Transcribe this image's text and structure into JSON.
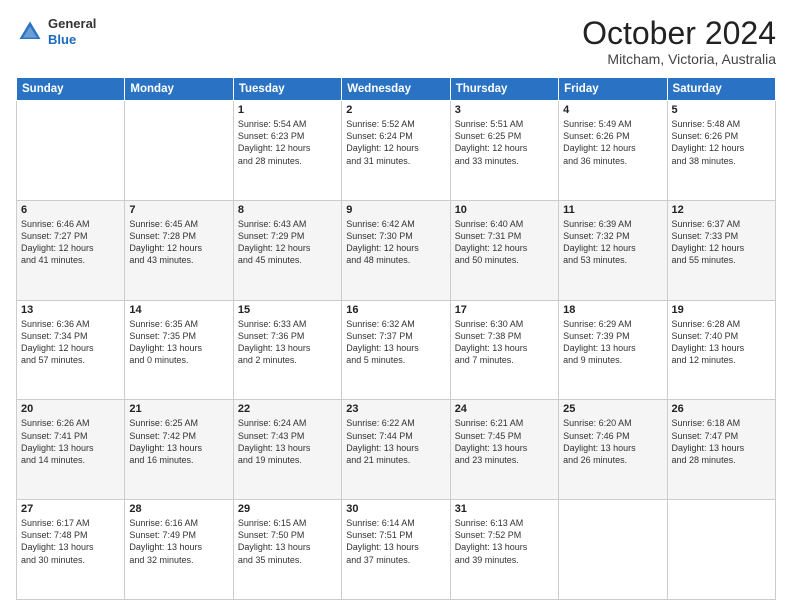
{
  "logo": {
    "general": "General",
    "blue": "Blue"
  },
  "header": {
    "month": "October 2024",
    "location": "Mitcham, Victoria, Australia"
  },
  "days": [
    "Sunday",
    "Monday",
    "Tuesday",
    "Wednesday",
    "Thursday",
    "Friday",
    "Saturday"
  ],
  "weeks": [
    [
      {
        "day": "",
        "content": ""
      },
      {
        "day": "",
        "content": ""
      },
      {
        "day": "1",
        "content": "Sunrise: 5:54 AM\nSunset: 6:23 PM\nDaylight: 12 hours\nand 28 minutes."
      },
      {
        "day": "2",
        "content": "Sunrise: 5:52 AM\nSunset: 6:24 PM\nDaylight: 12 hours\nand 31 minutes."
      },
      {
        "day": "3",
        "content": "Sunrise: 5:51 AM\nSunset: 6:25 PM\nDaylight: 12 hours\nand 33 minutes."
      },
      {
        "day": "4",
        "content": "Sunrise: 5:49 AM\nSunset: 6:26 PM\nDaylight: 12 hours\nand 36 minutes."
      },
      {
        "day": "5",
        "content": "Sunrise: 5:48 AM\nSunset: 6:26 PM\nDaylight: 12 hours\nand 38 minutes."
      }
    ],
    [
      {
        "day": "6",
        "content": "Sunrise: 6:46 AM\nSunset: 7:27 PM\nDaylight: 12 hours\nand 41 minutes."
      },
      {
        "day": "7",
        "content": "Sunrise: 6:45 AM\nSunset: 7:28 PM\nDaylight: 12 hours\nand 43 minutes."
      },
      {
        "day": "8",
        "content": "Sunrise: 6:43 AM\nSunset: 7:29 PM\nDaylight: 12 hours\nand 45 minutes."
      },
      {
        "day": "9",
        "content": "Sunrise: 6:42 AM\nSunset: 7:30 PM\nDaylight: 12 hours\nand 48 minutes."
      },
      {
        "day": "10",
        "content": "Sunrise: 6:40 AM\nSunset: 7:31 PM\nDaylight: 12 hours\nand 50 minutes."
      },
      {
        "day": "11",
        "content": "Sunrise: 6:39 AM\nSunset: 7:32 PM\nDaylight: 12 hours\nand 53 minutes."
      },
      {
        "day": "12",
        "content": "Sunrise: 6:37 AM\nSunset: 7:33 PM\nDaylight: 12 hours\nand 55 minutes."
      }
    ],
    [
      {
        "day": "13",
        "content": "Sunrise: 6:36 AM\nSunset: 7:34 PM\nDaylight: 12 hours\nand 57 minutes."
      },
      {
        "day": "14",
        "content": "Sunrise: 6:35 AM\nSunset: 7:35 PM\nDaylight: 13 hours\nand 0 minutes."
      },
      {
        "day": "15",
        "content": "Sunrise: 6:33 AM\nSunset: 7:36 PM\nDaylight: 13 hours\nand 2 minutes."
      },
      {
        "day": "16",
        "content": "Sunrise: 6:32 AM\nSunset: 7:37 PM\nDaylight: 13 hours\nand 5 minutes."
      },
      {
        "day": "17",
        "content": "Sunrise: 6:30 AM\nSunset: 7:38 PM\nDaylight: 13 hours\nand 7 minutes."
      },
      {
        "day": "18",
        "content": "Sunrise: 6:29 AM\nSunset: 7:39 PM\nDaylight: 13 hours\nand 9 minutes."
      },
      {
        "day": "19",
        "content": "Sunrise: 6:28 AM\nSunset: 7:40 PM\nDaylight: 13 hours\nand 12 minutes."
      }
    ],
    [
      {
        "day": "20",
        "content": "Sunrise: 6:26 AM\nSunset: 7:41 PM\nDaylight: 13 hours\nand 14 minutes."
      },
      {
        "day": "21",
        "content": "Sunrise: 6:25 AM\nSunset: 7:42 PM\nDaylight: 13 hours\nand 16 minutes."
      },
      {
        "day": "22",
        "content": "Sunrise: 6:24 AM\nSunset: 7:43 PM\nDaylight: 13 hours\nand 19 minutes."
      },
      {
        "day": "23",
        "content": "Sunrise: 6:22 AM\nSunset: 7:44 PM\nDaylight: 13 hours\nand 21 minutes."
      },
      {
        "day": "24",
        "content": "Sunrise: 6:21 AM\nSunset: 7:45 PM\nDaylight: 13 hours\nand 23 minutes."
      },
      {
        "day": "25",
        "content": "Sunrise: 6:20 AM\nSunset: 7:46 PM\nDaylight: 13 hours\nand 26 minutes."
      },
      {
        "day": "26",
        "content": "Sunrise: 6:18 AM\nSunset: 7:47 PM\nDaylight: 13 hours\nand 28 minutes."
      }
    ],
    [
      {
        "day": "27",
        "content": "Sunrise: 6:17 AM\nSunset: 7:48 PM\nDaylight: 13 hours\nand 30 minutes."
      },
      {
        "day": "28",
        "content": "Sunrise: 6:16 AM\nSunset: 7:49 PM\nDaylight: 13 hours\nand 32 minutes."
      },
      {
        "day": "29",
        "content": "Sunrise: 6:15 AM\nSunset: 7:50 PM\nDaylight: 13 hours\nand 35 minutes."
      },
      {
        "day": "30",
        "content": "Sunrise: 6:14 AM\nSunset: 7:51 PM\nDaylight: 13 hours\nand 37 minutes."
      },
      {
        "day": "31",
        "content": "Sunrise: 6:13 AM\nSunset: 7:52 PM\nDaylight: 13 hours\nand 39 minutes."
      },
      {
        "day": "",
        "content": ""
      },
      {
        "day": "",
        "content": ""
      }
    ]
  ]
}
